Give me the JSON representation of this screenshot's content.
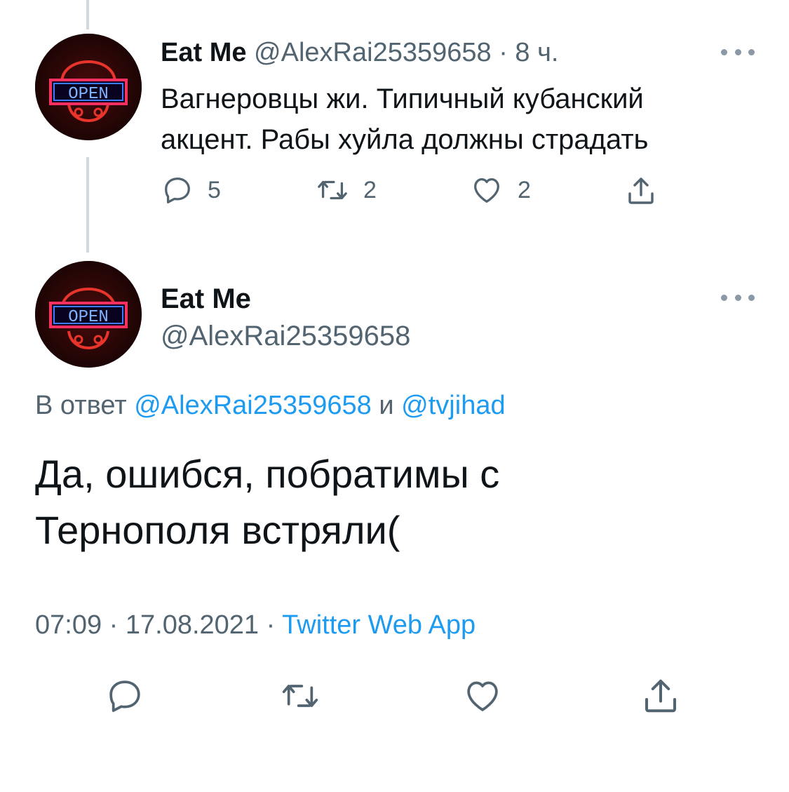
{
  "reply_tweet": {
    "display_name": "Eat Me",
    "handle": "@AlexRai25359658",
    "separator": "·",
    "time": "8 ч.",
    "text_line1": "Вагнеровцы жи. Типичный кубанский",
    "text_line2": "акцент. Рабы хуйла должны страдать",
    "reply_count": "5",
    "retweet_count": "2",
    "like_count": "2"
  },
  "main_tweet": {
    "display_name": "Eat Me",
    "handle": "@AlexRai25359658",
    "reply_prefix": "В ответ",
    "reply_user1": "@AlexRai25359658",
    "reply_and": "и",
    "reply_user2": "@tvjihad",
    "text_line1": "Да, ошибся, побратимы с",
    "text_line2": "Тернополя встряли(",
    "time": "07:09",
    "dot1": "·",
    "date": "17.08.2021",
    "dot2": "·",
    "source": "Twitter Web App"
  },
  "avatar_sign_text": "OPEN",
  "icons": [
    "reply-icon",
    "retweet-icon",
    "like-icon",
    "share-icon",
    "more-icon"
  ],
  "colors": {
    "text": "#0f1419",
    "muted": "#536471",
    "link": "#1d9bf0",
    "thread_line": "#cfd9de"
  }
}
